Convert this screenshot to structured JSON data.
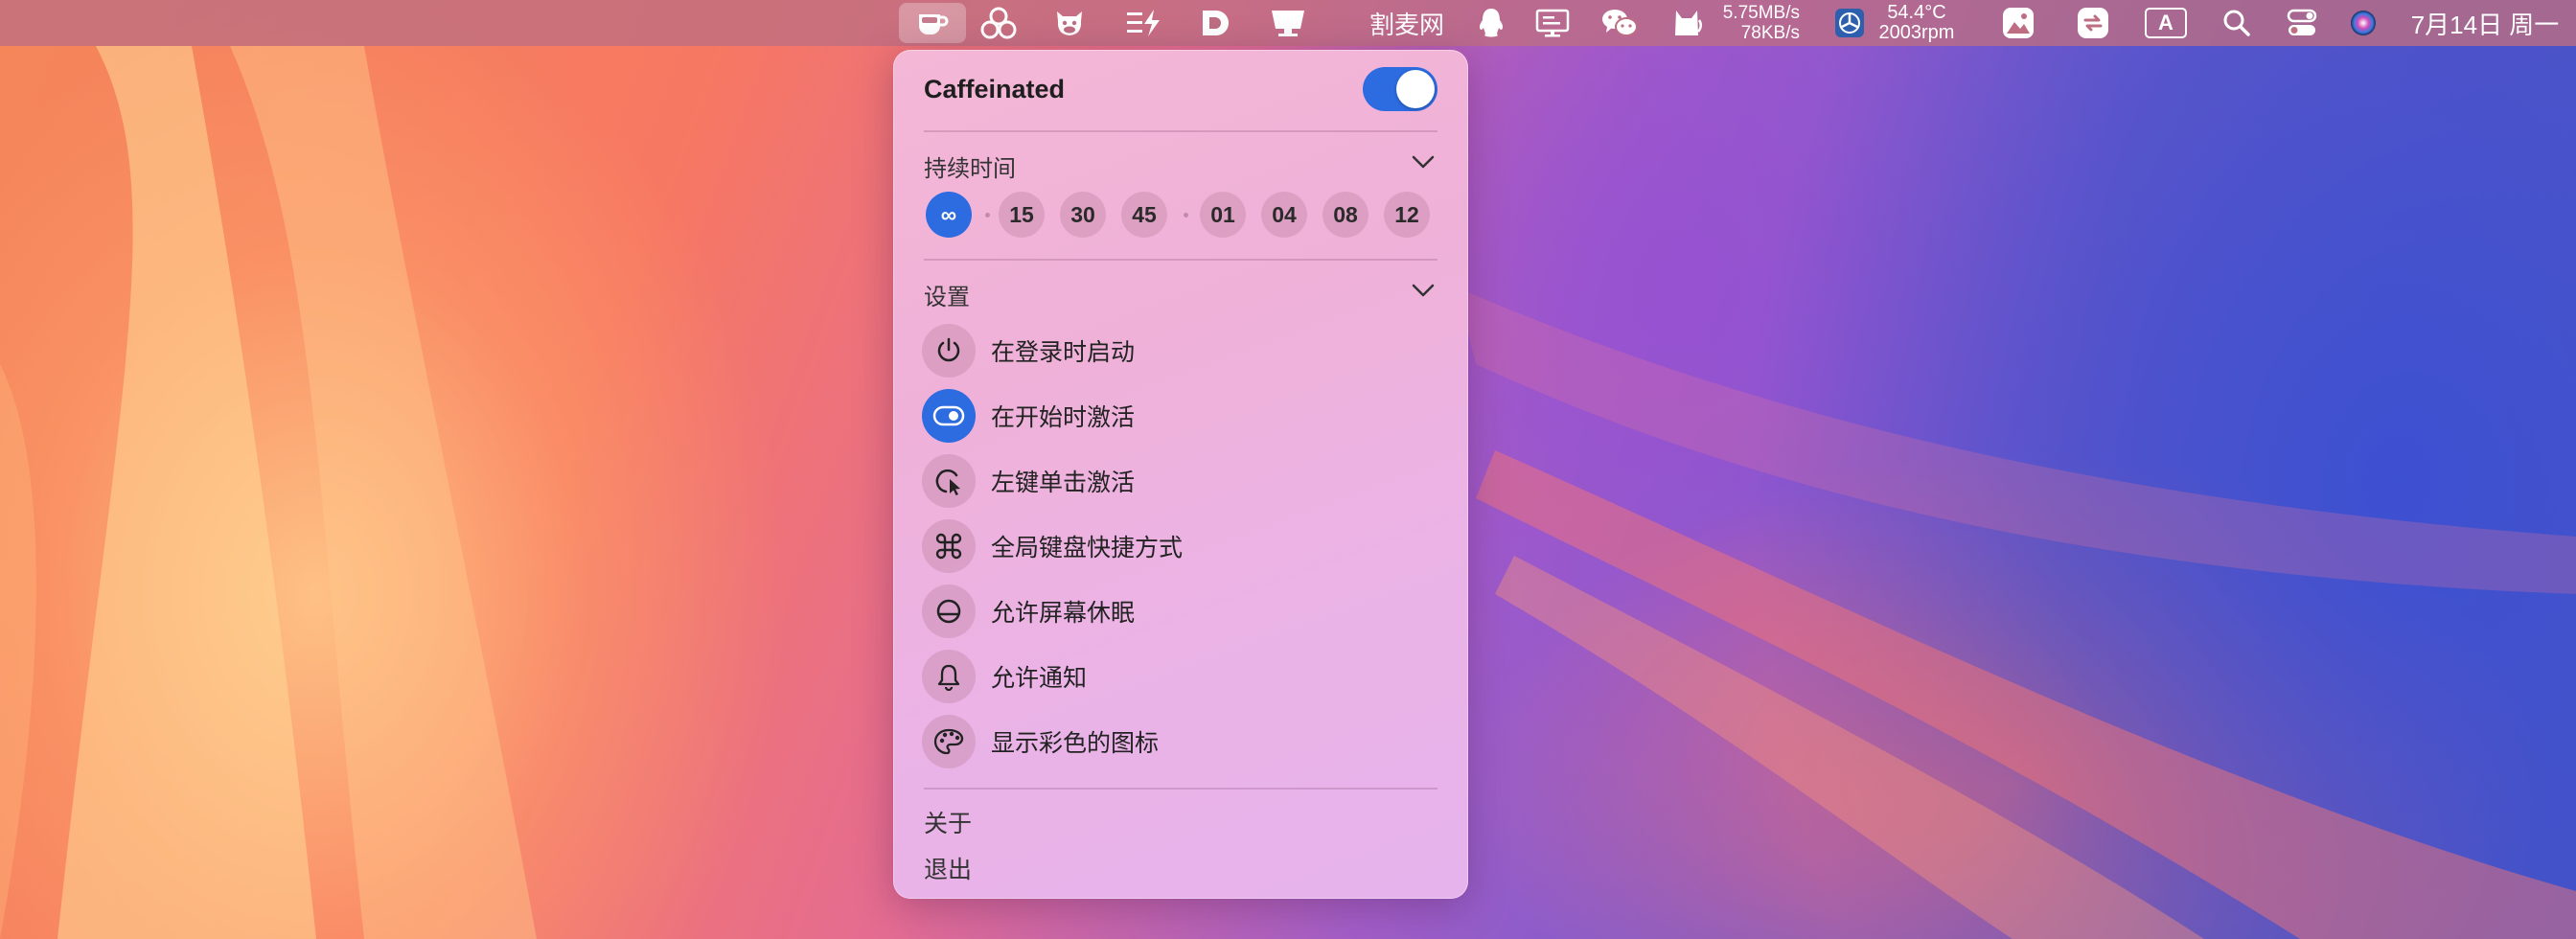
{
  "menubar": {
    "items": [
      {
        "icon": "coffee-cup-icon",
        "active": true
      },
      {
        "icon": "three-circles-icon"
      },
      {
        "icon": "cow-icon"
      },
      {
        "icon": "list-bolt-icon"
      },
      {
        "icon": "d-logo-icon"
      },
      {
        "icon": "display-icon"
      }
    ],
    "gemai_label": "割麦网",
    "network": {
      "up": "5.75MB/s",
      "down": "78KB/s"
    },
    "sensor": {
      "temp": "54.4°C",
      "fan": "2003rpm"
    },
    "input_method": "A",
    "datetime": "7月14日 周一"
  },
  "popover": {
    "title": "Caffeinated",
    "caffeinated_on": true,
    "duration": {
      "label": "持续时间",
      "options": [
        "∞",
        "15",
        "30",
        "45",
        "01",
        "04",
        "08",
        "12"
      ],
      "selected": "∞"
    },
    "settings": {
      "label": "设置",
      "options": [
        {
          "icon": "power-icon",
          "label": "在登录时启动",
          "enabled": false
        },
        {
          "icon": "toggle-icon",
          "label": "在开始时激活",
          "enabled": true
        },
        {
          "icon": "cursor-click-icon",
          "label": "左键单击激活",
          "enabled": false
        },
        {
          "icon": "command-icon",
          "label": "全局键盘快捷方式",
          "enabled": false
        },
        {
          "icon": "screen-sleep-icon",
          "label": "允许屏幕休眠",
          "enabled": false
        },
        {
          "icon": "bell-icon",
          "label": "允许通知",
          "enabled": false
        },
        {
          "icon": "palette-icon",
          "label": "显示彩色的图标",
          "enabled": false
        }
      ]
    },
    "about_label": "关于",
    "quit_label": "退出"
  },
  "colors": {
    "accent": "#2c6be0",
    "popover_bg": "#efb3dc"
  }
}
